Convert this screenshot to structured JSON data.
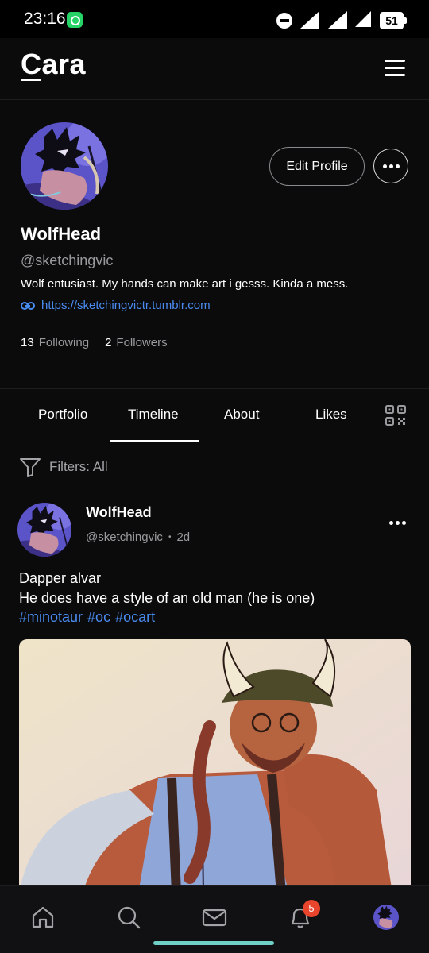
{
  "status_bar": {
    "time": "23:16",
    "battery": "51",
    "icons": [
      "whatsapp-icon",
      "do-not-disturb-icon",
      "wifi-icon",
      "signal-icon",
      "battery-icon"
    ]
  },
  "header": {
    "logo": "Cara",
    "menu_icon": "hamburger-menu-icon"
  },
  "profile": {
    "display_name": "WolfHead",
    "handle": "@sketchingvic",
    "bio": "Wolf entusiast. My hands can make art i gesss. Kinda a mess.",
    "link": "https://sketchingvictr.tumblr.com",
    "following_count": "13",
    "following_label": "Following",
    "followers_count": "2",
    "followers_label": "Followers",
    "edit_button": "Edit Profile"
  },
  "tabs": {
    "items": [
      {
        "label": "Portfolio"
      },
      {
        "label": "Timeline",
        "active": true
      },
      {
        "label": "About"
      },
      {
        "label": "Likes"
      }
    ]
  },
  "filters": {
    "label": "Filters: All"
  },
  "post": {
    "author": "WolfHead",
    "handle": "@sketchingvic",
    "separator": "•",
    "age": "2d",
    "lines": [
      "Dapper alvar",
      "He does have a style of an old man (he is one)"
    ],
    "tags": [
      "#minotaur",
      "#oc",
      "#ocart"
    ]
  },
  "bottom_nav": {
    "items": [
      "home-icon",
      "search-icon",
      "mail-icon",
      "bell-icon",
      "profile-avatar"
    ],
    "notification_badge": "5"
  },
  "colors": {
    "background": "#0b0b0c",
    "accent_link": "#4a8bf0",
    "badge": "#e8452c",
    "home_indicator": "#6fd0c6"
  }
}
